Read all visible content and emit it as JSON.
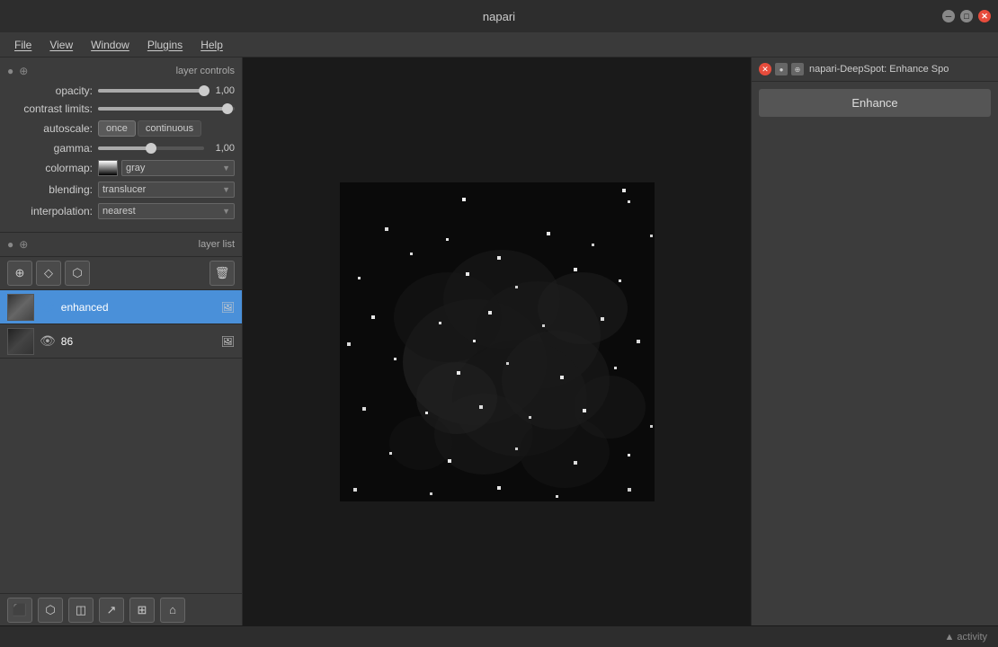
{
  "app": {
    "title": "napari",
    "right_panel_title": "napari-DeepSpot: Enhance Spo"
  },
  "menu": {
    "items": [
      {
        "label": "File",
        "underline": true
      },
      {
        "label": "View",
        "underline": true
      },
      {
        "label": "Window",
        "underline": true
      },
      {
        "label": "Plugins",
        "underline": true
      },
      {
        "label": "Help",
        "underline": true
      }
    ]
  },
  "layer_controls": {
    "header": "layer controls",
    "opacity": {
      "label": "opacity:",
      "value": "1,00",
      "percent": 100
    },
    "contrast_limits": {
      "label": "contrast limits:",
      "percent": 95
    },
    "autoscale": {
      "label": "autoscale:",
      "buttons": [
        "once",
        "continuous"
      ],
      "active": "once"
    },
    "gamma": {
      "label": "gamma:",
      "value": "1,00",
      "percent": 50
    },
    "colormap": {
      "label": "colormap:",
      "value": "gray"
    },
    "blending": {
      "label": "blending:",
      "value": "translucer"
    },
    "interpolation": {
      "label": "interpolation:",
      "value": "nearest"
    }
  },
  "layer_list": {
    "header": "layer list",
    "layers": [
      {
        "id": "enhanced",
        "name": "enhanced",
        "active": true,
        "visible": true
      },
      {
        "id": "86",
        "name": "86",
        "active": false,
        "visible": true
      }
    ]
  },
  "enhance_button": {
    "label": "Enhance"
  },
  "status_bar": {
    "text": "▲ activity"
  },
  "bottom_toolbar": {
    "buttons": [
      "terminal",
      "shapes",
      "cube",
      "arrow",
      "grid",
      "home"
    ]
  }
}
